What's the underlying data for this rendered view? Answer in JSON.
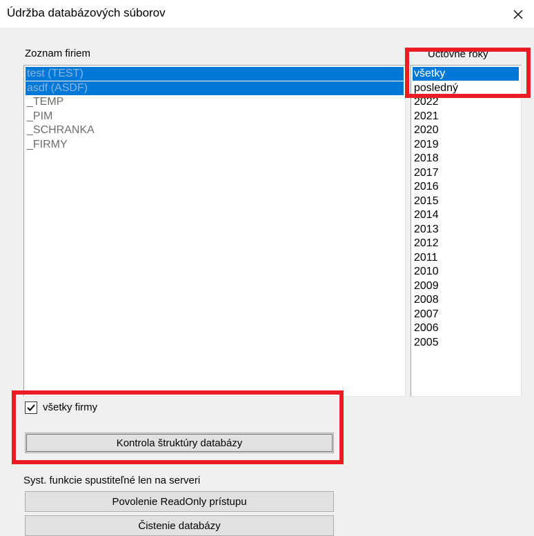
{
  "window": {
    "title": "Údržba databázových súborov",
    "close_icon": "close-icon"
  },
  "companies": {
    "label": "Zoznam firiem",
    "items": [
      {
        "label": "test (TEST)",
        "selected": true
      },
      {
        "label": "asdf (ASDF)",
        "selected": true
      },
      {
        "label": "_TEMP",
        "selected": false
      },
      {
        "label": "_PIM",
        "selected": false
      },
      {
        "label": "_SCHRANKA",
        "selected": false
      },
      {
        "label": "_FIRMY",
        "selected": false
      }
    ]
  },
  "years": {
    "label": "Účtovné roky",
    "items": [
      {
        "label": "všetky",
        "selected": true
      },
      {
        "label": "posledný",
        "selected": false
      },
      {
        "label": "2022",
        "selected": false
      },
      {
        "label": "2021",
        "selected": false
      },
      {
        "label": "2020",
        "selected": false
      },
      {
        "label": "2019",
        "selected": false
      },
      {
        "label": "2018",
        "selected": false
      },
      {
        "label": "2017",
        "selected": false
      },
      {
        "label": "2016",
        "selected": false
      },
      {
        "label": "2015",
        "selected": false
      },
      {
        "label": "2014",
        "selected": false
      },
      {
        "label": "2013",
        "selected": false
      },
      {
        "label": "2012",
        "selected": false
      },
      {
        "label": "2011",
        "selected": false
      },
      {
        "label": "2010",
        "selected": false
      },
      {
        "label": "2009",
        "selected": false
      },
      {
        "label": "2008",
        "selected": false
      },
      {
        "label": "2007",
        "selected": false
      },
      {
        "label": "2006",
        "selected": false
      },
      {
        "label": "2005",
        "selected": false
      }
    ]
  },
  "all_companies": {
    "label": "všetky firmy",
    "checked": true
  },
  "buttons": {
    "check_structure": "Kontrola štruktúry databázy",
    "readonly_access": "Povolenie ReadOnly prístupu",
    "clean_database": "Čistenie databázy"
  },
  "server_section": {
    "label": "Syst. funkcie spustiteľné len na serveri"
  },
  "annotation_color": "#ec1c24",
  "selection_color": "#0078d7"
}
